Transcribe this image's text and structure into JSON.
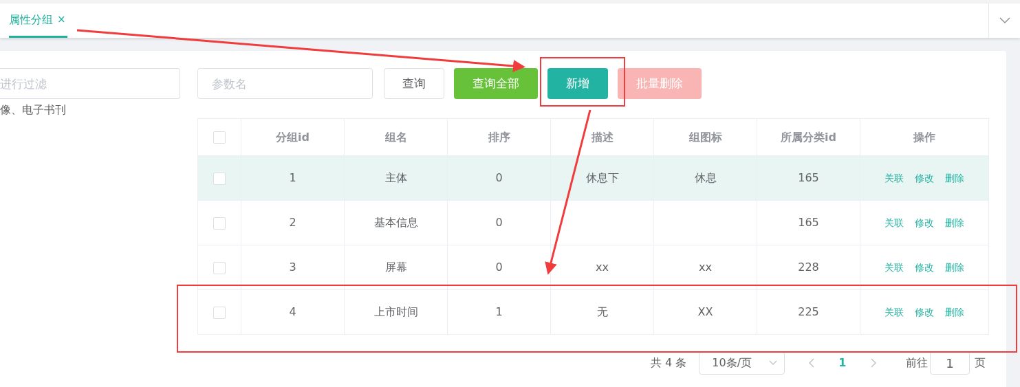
{
  "tabs": [
    {
      "label": "属性分组",
      "close": "×",
      "selected": true
    }
  ],
  "tree": {
    "filter_placeholder": "进行过滤",
    "items": [
      {
        "label": "像、电子书刊"
      }
    ]
  },
  "search": {
    "placeholder": "参数名"
  },
  "buttons": [
    {
      "label": "查询",
      "kind": "plain",
      "disabled": false
    },
    {
      "label": "查询全部",
      "kind": "success",
      "disabled": false
    },
    {
      "label": "新增",
      "kind": "primary",
      "disabled": false
    },
    {
      "label": "批量删除",
      "kind": "danger",
      "disabled": true
    }
  ],
  "table": {
    "header_checked": false,
    "columns": [
      "分组id",
      "组名",
      "排序",
      "描述",
      "组图标",
      "所属分类id",
      "操作"
    ],
    "rows": [
      {
        "checked": false,
        "highlighted": true,
        "cells": [
          "1",
          "主体",
          "0",
          "休息下",
          "休息",
          "165"
        ],
        "actions": [
          "关联",
          "修改",
          "删除"
        ]
      },
      {
        "checked": false,
        "highlighted": false,
        "cells": [
          "2",
          "基本信息",
          "0",
          "",
          "",
          "165"
        ],
        "actions": [
          "关联",
          "修改",
          "删除"
        ]
      },
      {
        "checked": false,
        "highlighted": false,
        "cells": [
          "3",
          "屏幕",
          "0",
          "xx",
          "xx",
          "228"
        ],
        "actions": [
          "关联",
          "修改",
          "删除"
        ]
      },
      {
        "checked": false,
        "highlighted": false,
        "cells": [
          "4",
          "上市时间",
          "1",
          "无",
          "XX",
          "225"
        ],
        "actions": [
          "关联",
          "修改",
          "删除"
        ]
      }
    ]
  },
  "pagination": {
    "total": "共 4 条",
    "page_size": "10条/页",
    "pages": [
      {
        "label": "1",
        "selected": true
      }
    ],
    "goto_label": "前往",
    "goto_value": "1",
    "page_suffix": "页"
  }
}
